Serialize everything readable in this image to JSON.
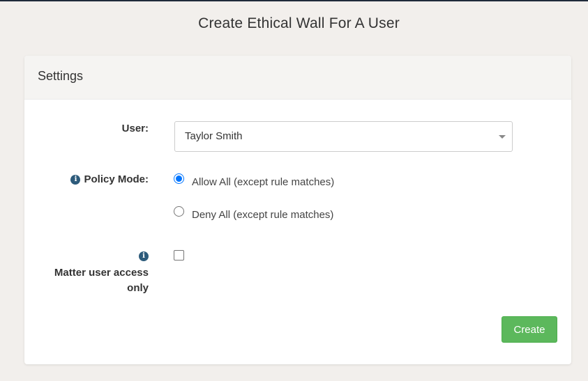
{
  "page": {
    "title": "Create Ethical Wall For A User"
  },
  "settings": {
    "header": "Settings",
    "user": {
      "label": "User:",
      "selected_value": "Taylor Smith"
    },
    "policy_mode": {
      "label": "Policy Mode:",
      "info_icon": "info-icon",
      "options": [
        {
          "label": "Allow All (except rule matches)",
          "checked": true
        },
        {
          "label": "Deny All (except rule matches)",
          "checked": false
        }
      ]
    },
    "matter_access": {
      "label": "Matter user access only",
      "info_icon": "info-icon",
      "checked": false
    },
    "create_label": "Create"
  },
  "colors": {
    "background": "#f2efec",
    "card": "#ffffff",
    "card_header": "#f5f4f2",
    "info_icon": "#2d5b7b",
    "radio_accent": "#0075ff",
    "create_button": "#5cb85c"
  }
}
